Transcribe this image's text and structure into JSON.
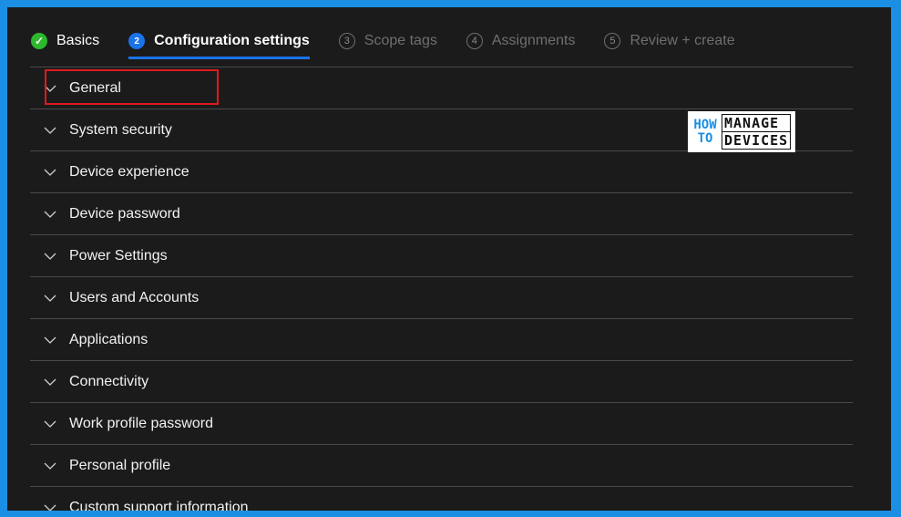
{
  "wizard": {
    "steps": [
      {
        "number": "✓",
        "label": "Basics",
        "state": "done"
      },
      {
        "number": "2",
        "label": "Configuration settings",
        "state": "active"
      },
      {
        "number": "3",
        "label": "Scope tags",
        "state": "pending"
      },
      {
        "number": "4",
        "label": "Assignments",
        "state": "pending"
      },
      {
        "number": "5",
        "label": "Review + create",
        "state": "pending"
      }
    ]
  },
  "sections": [
    {
      "label": "General"
    },
    {
      "label": "System security"
    },
    {
      "label": "Device experience"
    },
    {
      "label": "Device password"
    },
    {
      "label": "Power Settings"
    },
    {
      "label": "Users and Accounts"
    },
    {
      "label": "Applications"
    },
    {
      "label": "Connectivity"
    },
    {
      "label": "Work profile password"
    },
    {
      "label": "Personal profile"
    },
    {
      "label": "Custom support information"
    }
  ],
  "logo": {
    "how": "HOW",
    "to": "TO",
    "manage": "MANAGE",
    "devices": "DEVICES"
  },
  "colors": {
    "background_border": "#1a8fe3",
    "panel": "#1b1b1b",
    "active_accent": "#1a73e8",
    "done_check": "#2eb82e",
    "highlight_box": "#e0191e"
  },
  "icons": {
    "section_expander": "chevron-down-icon",
    "done_step": "checkmark-icon"
  }
}
